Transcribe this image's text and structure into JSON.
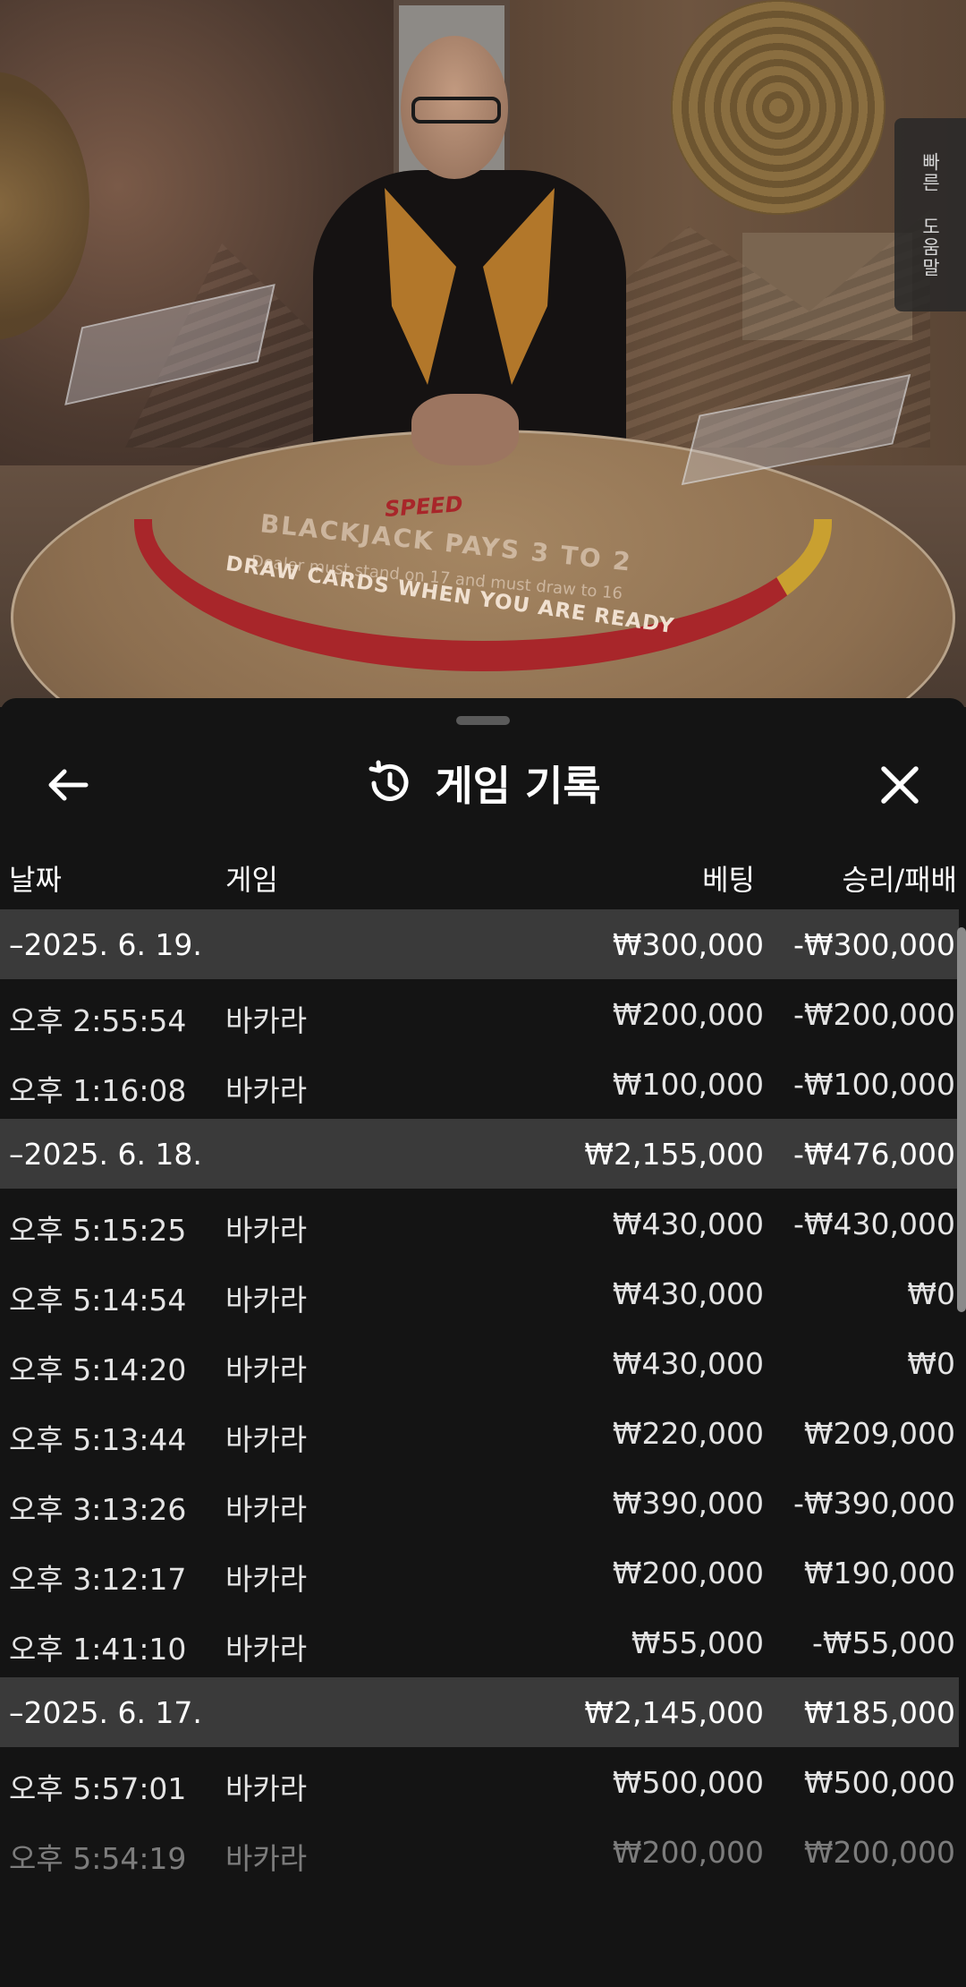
{
  "side_tab": {
    "line1": "빠른",
    "line2": "도움말"
  },
  "scene": {
    "speed_logo": "SPEED",
    "table_line1": "BLACKJACK PAYS 3 TO 2",
    "table_line2": "Dealer must stand on 17 and must draw to 16",
    "table_line3": "DRAW CARDS WHEN YOU ARE READY"
  },
  "panel": {
    "title": "게임 기록",
    "icons": {
      "back": "arrow-left-icon",
      "history": "history-icon",
      "close": "close-icon"
    }
  },
  "columns": {
    "date": "날짜",
    "game": "게임",
    "bet": "베팅",
    "winloss": "승리/패배"
  },
  "rows": [
    {
      "type": "date",
      "time": "–2025. 6. 19.",
      "game": "",
      "bet": "₩300,000",
      "winloss": "-₩300,000"
    },
    {
      "type": "entry",
      "time": "오후 2:55:54",
      "game": "바카라",
      "bet": "₩200,000",
      "winloss": "-₩200,000"
    },
    {
      "type": "entry",
      "time": "오후 1:16:08",
      "game": "바카라",
      "bet": "₩100,000",
      "winloss": "-₩100,000"
    },
    {
      "type": "date",
      "time": "–2025. 6. 18.",
      "game": "",
      "bet": "₩2,155,000",
      "winloss": "-₩476,000"
    },
    {
      "type": "entry",
      "time": "오후 5:15:25",
      "game": "바카라",
      "bet": "₩430,000",
      "winloss": "-₩430,000"
    },
    {
      "type": "entry",
      "time": "오후 5:14:54",
      "game": "바카라",
      "bet": "₩430,000",
      "winloss": "₩0"
    },
    {
      "type": "entry",
      "time": "오후 5:14:20",
      "game": "바카라",
      "bet": "₩430,000",
      "winloss": "₩0"
    },
    {
      "type": "entry",
      "time": "오후 5:13:44",
      "game": "바카라",
      "bet": "₩220,000",
      "winloss": "₩209,000"
    },
    {
      "type": "entry",
      "time": "오후 3:13:26",
      "game": "바카라",
      "bet": "₩390,000",
      "winloss": "-₩390,000"
    },
    {
      "type": "entry",
      "time": "오후 3:12:17",
      "game": "바카라",
      "bet": "₩200,000",
      "winloss": "₩190,000"
    },
    {
      "type": "entry",
      "time": "오후 1:41:10",
      "game": "바카라",
      "bet": "₩55,000",
      "winloss": "-₩55,000"
    },
    {
      "type": "date",
      "time": "–2025. 6. 17.",
      "game": "",
      "bet": "₩2,145,000",
      "winloss": "₩185,000"
    },
    {
      "type": "entry",
      "time": "오후 5:57:01",
      "game": "바카라",
      "bet": "₩500,000",
      "winloss": "₩500,000"
    },
    {
      "type": "entry",
      "time": "오후 5:54:19",
      "game": "바카라",
      "bet": "₩200,000",
      "winloss": "₩200,000",
      "faded": true
    }
  ]
}
